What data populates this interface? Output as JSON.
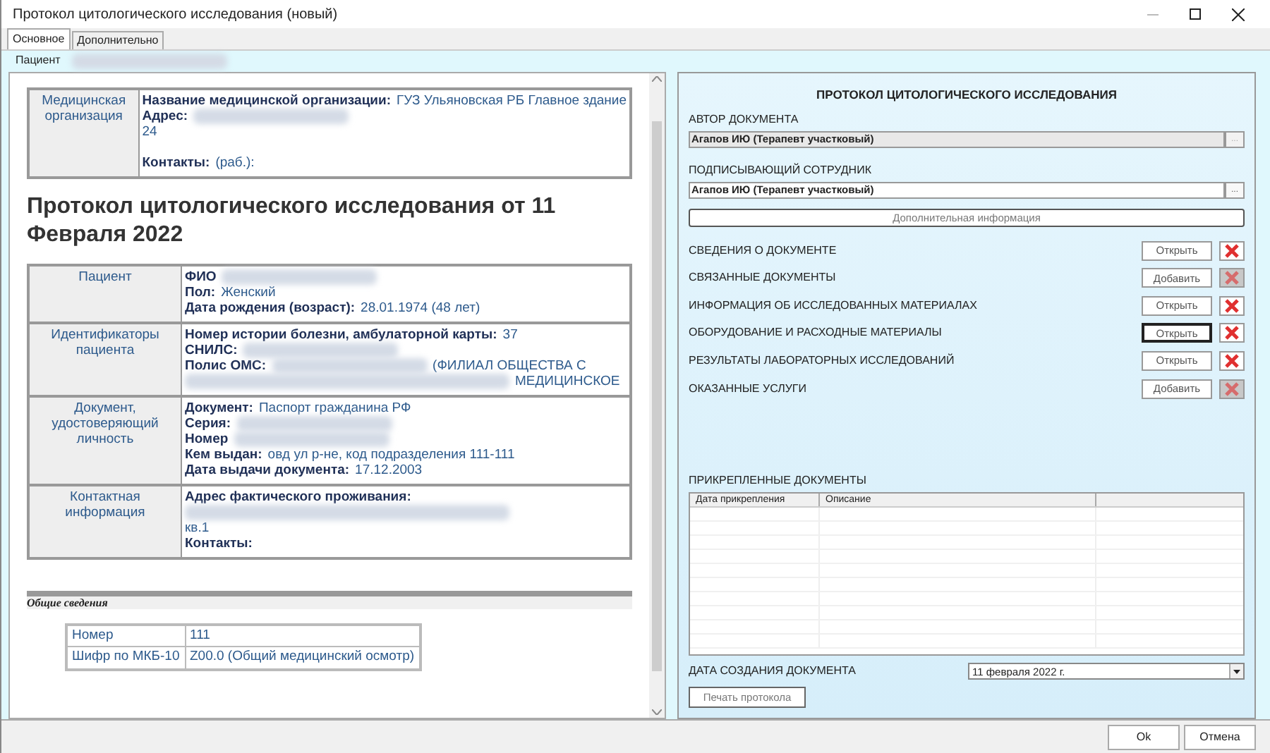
{
  "window": {
    "title": "Протокол цитологического исследования (новый)"
  },
  "tabs": [
    {
      "label": "Основное",
      "selected": true
    },
    {
      "label": "Дополнительно",
      "selected": false
    }
  ],
  "patient_bar": {
    "label": "Пациент",
    "parts": [
      {
        "kind": "blur"
      }
    ]
  },
  "document": {
    "org_table": {
      "label": "Медицинская организация",
      "lines": [
        {
          "parts": [
            {
              "kind": "key",
              "text": "Название медицинской организации:"
            },
            {
              "kind": "value",
              "text": "ГУЗ Ульяновская РБ Главное здание"
            }
          ]
        },
        {
          "parts": [
            {
              "kind": "key",
              "text": "Адрес:"
            },
            {
              "kind": "blur"
            }
          ]
        },
        {
          "parts": [
            {
              "kind": "value",
              "text": "24"
            }
          ]
        },
        {
          "parts": [
            {
              "kind": "gap"
            }
          ]
        },
        {
          "parts": [
            {
              "kind": "key",
              "text": "Контакты:"
            },
            {
              "kind": "value",
              "text": "(раб.):"
            }
          ]
        }
      ]
    },
    "title": "Протокол цитологического исследования от 11 Февраля 2022",
    "patient_table": [
      {
        "label": "Пациент",
        "lines": [
          {
            "parts": [
              {
                "kind": "key",
                "text": "ФИО"
              },
              {
                "kind": "blur"
              }
            ]
          },
          {
            "parts": [
              {
                "kind": "key",
                "text": "Пол:"
              },
              {
                "kind": "value",
                "text": "Женский"
              }
            ]
          },
          {
            "parts": [
              {
                "kind": "key",
                "text": "Дата рождения (возраст):"
              },
              {
                "kind": "value",
                "text": "28.01.1974 (48 лет)"
              }
            ]
          }
        ]
      },
      {
        "label": "Идентификаторы пациента",
        "lines": [
          {
            "parts": [
              {
                "kind": "key",
                "text": "Номер истории болезни, амбулаторной карты:"
              },
              {
                "kind": "value",
                "text": "37"
              }
            ]
          },
          {
            "parts": [
              {
                "kind": "key",
                "text": "СНИЛС:"
              },
              {
                "kind": "blur"
              }
            ]
          },
          {
            "parts": [
              {
                "kind": "key",
                "text": "Полис ОМС:"
              },
              {
                "kind": "blur"
              },
              {
                "kind": "value",
                "text": "(ФИЛИАЛ ОБЩЕСТВА С"
              }
            ]
          },
          {
            "parts": [
              {
                "kind": "blur"
              },
              {
                "kind": "value",
                "text": "МЕДИЦИНСКОЕ"
              }
            ]
          }
        ]
      },
      {
        "label": "Документ, удостоверяющий личность",
        "lines": [
          {
            "parts": [
              {
                "kind": "key",
                "text": "Документ:"
              },
              {
                "kind": "value",
                "text": "Паспорт гражданина РФ"
              }
            ]
          },
          {
            "parts": [
              {
                "kind": "key",
                "text": "Серия:"
              },
              {
                "kind": "blur"
              }
            ]
          },
          {
            "parts": [
              {
                "kind": "key",
                "text": "Номер"
              },
              {
                "kind": "blur"
              }
            ]
          },
          {
            "parts": [
              {
                "kind": "key",
                "text": "Кем выдан:"
              },
              {
                "kind": "value",
                "text": "овд ул р-не, код подразделения 111-111"
              }
            ]
          },
          {
            "parts": [
              {
                "kind": "key",
                "text": "Дата выдачи документа:"
              },
              {
                "kind": "value",
                "text": "17.12.2003"
              }
            ]
          }
        ]
      },
      {
        "label": "Контактная информация",
        "lines": [
          {
            "parts": [
              {
                "kind": "key",
                "text": "Адрес фактического проживания:"
              }
            ]
          },
          {
            "parts": [
              {
                "kind": "blur"
              }
            ]
          },
          {
            "parts": [
              {
                "kind": "value",
                "text": "кв.1"
              }
            ]
          },
          {
            "parts": [
              {
                "kind": "key",
                "text": "Контакты:"
              }
            ]
          }
        ]
      }
    ],
    "section_title": "Общие сведения",
    "info_table": [
      {
        "label": "Номер",
        "value": "111"
      },
      {
        "label": "Шифр по МКБ-10",
        "value": "Z00.0 (Общий медицинский осмотр)"
      }
    ]
  },
  "form": {
    "title": "ПРОТОКОЛ ЦИТОЛОГИЧЕСКОГО ИССЛЕДОВАНИЯ",
    "author": {
      "label": "АВТОР ДОКУМЕНТА",
      "value": "Агапов ИЮ (Терапевт участковый)",
      "button": "...",
      "disabled": true
    },
    "signer": {
      "label": "ПОДПИСЫВАЮЩИЙ СОТРУДНИК",
      "value": "Агапов ИЮ (Терапевт участковый)",
      "button": "...",
      "disabled": false
    },
    "extra_button": "Дополнительная информация",
    "sections": [
      {
        "label": "СВЕДЕНИЯ О ДОКУМЕНТЕ",
        "action": "Открыть",
        "focused": false,
        "delete_disabled": false
      },
      {
        "label": "СВЯЗАННЫЕ ДОКУМЕНТЫ",
        "action": "Добавить",
        "focused": false,
        "delete_disabled": true
      },
      {
        "label": "ИНФОРМАЦИЯ ОБ ИССЛЕДОВАННЫХ МАТЕРИАЛАХ",
        "action": "Открыть",
        "focused": false,
        "delete_disabled": false
      },
      {
        "label": "ОБОРУДОВАНИЕ И РАСХОДНЫЕ МАТЕРИАЛЫ",
        "action": "Открыть",
        "focused": true,
        "delete_disabled": false
      },
      {
        "label": "РЕЗУЛЬТАТЫ ЛАБОРАТОРНЫХ ИССЛЕДОВАНИЙ",
        "action": "Открыть",
        "focused": false,
        "delete_disabled": false
      },
      {
        "label": "ОКАЗАННЫЕ УСЛУГИ",
        "action": "Добавить",
        "focused": false,
        "delete_disabled": true
      }
    ],
    "attachments": {
      "label": "ПРИКРЕПЛЕННЫЕ ДОКУМЕНТЫ",
      "columns": [
        "Дата прикрепления",
        "Описание"
      ]
    },
    "date": {
      "label": "ДАТА СОЗДАНИЯ ДОКУМЕНТА",
      "value": "11 февраля  2022 г."
    },
    "print_button": "Печать протокола"
  },
  "buttons": [
    "Ok",
    "Отмена"
  ]
}
